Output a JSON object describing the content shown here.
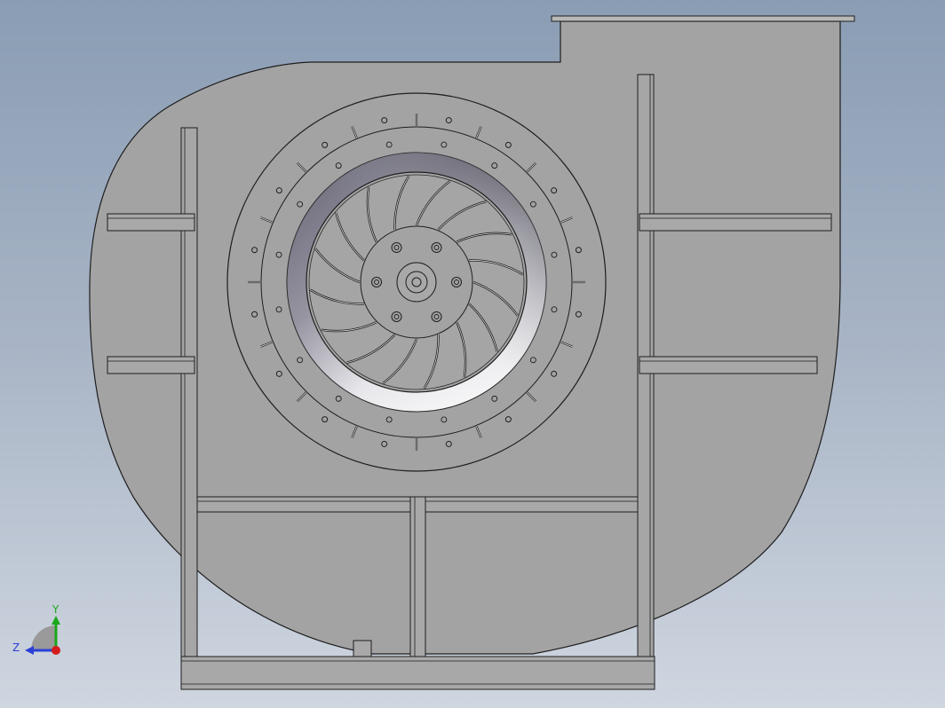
{
  "viewport": {
    "background_top": "#8a9db4",
    "background_bottom": "#cfd6e0"
  },
  "model": {
    "casing_color": "#a3a3a3",
    "edge_color": "#1e1e1e",
    "impeller_blade_count": 16,
    "inlet_ring_hole_count": 16,
    "outer_ring_hole_count": 16,
    "outer_ring_slot_count": 16,
    "hub_bolt_count": 6
  },
  "triad": {
    "y_label": "Y",
    "z_label": "Z",
    "y_color": "#1aa81a",
    "z_color": "#2a3fd6",
    "x_dot_color": "#d41c1c"
  }
}
